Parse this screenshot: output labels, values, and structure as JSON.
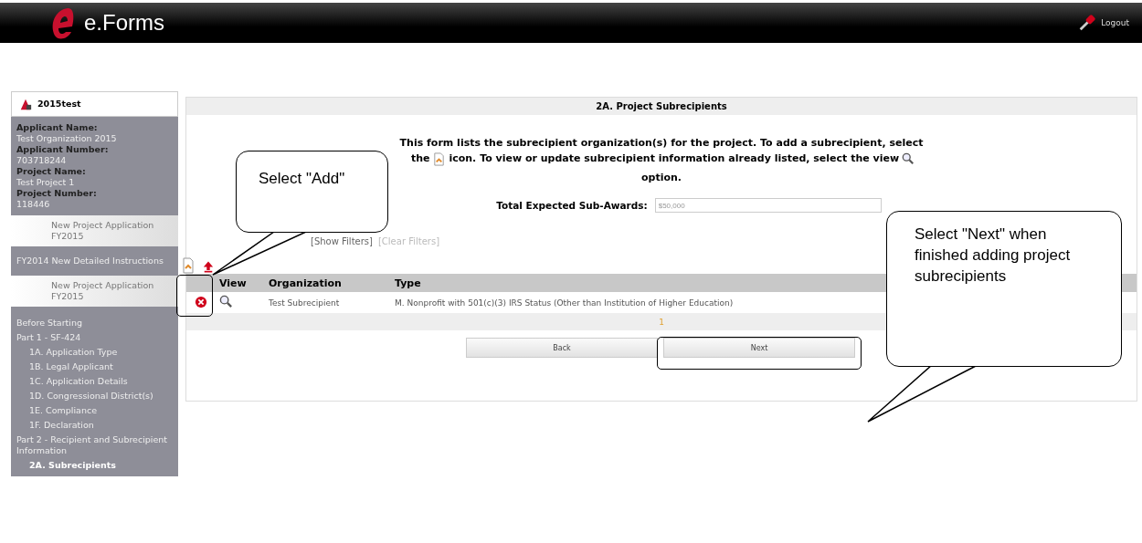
{
  "header": {
    "app_name": "e.Forms",
    "logout": "Logout"
  },
  "sidebar": {
    "title": "2015test",
    "info": [
      {
        "label": "Applicant Name:",
        "value": "Test Organization 2015"
      },
      {
        "label": "Applicant Number:",
        "value": "703718244"
      },
      {
        "label": "Project Name:",
        "value": "Test Project 1"
      },
      {
        "label": "Project Number:",
        "value": "118446"
      }
    ],
    "links": [
      {
        "text": "New Project Application FY2015",
        "kind": "tab"
      },
      {
        "text": "FY2014 New Detailed Instructions",
        "kind": "link"
      },
      {
        "text": "New Project Application FY2015",
        "kind": "tab"
      }
    ],
    "nav": [
      {
        "text": "Before Starting",
        "selected": false
      },
      {
        "text": "Part 1 - SF-424",
        "selected": false,
        "children": [
          {
            "text": "1A. Application Type",
            "selected": false
          },
          {
            "text": "1B. Legal Applicant",
            "selected": false
          },
          {
            "text": "1C. Application Details",
            "selected": false
          },
          {
            "text": "1D. Congressional District(s)",
            "selected": false
          },
          {
            "text": "1E. Compliance",
            "selected": false
          },
          {
            "text": "1F. Declaration",
            "selected": false
          }
        ]
      },
      {
        "text": "Part 2 - Recipient and Subrecipient Information",
        "selected": false,
        "children": [
          {
            "text": "2A. Subrecipients",
            "selected": true
          }
        ]
      }
    ]
  },
  "form": {
    "title": "2A. Project Subrecipients",
    "instructions": [
      "This form lists the subrecipient organization(s) for the project. To add a subrecipient, select",
      "the",
      "icon. To view or update subrecipient information already listed, select the view",
      "option."
    ],
    "field": {
      "label": "Total Expected Sub-Awards:",
      "value": "$50,000"
    },
    "filters": [
      "[Show Filters]",
      "[Clear Filters]"
    ],
    "table": {
      "columns": [
        "View",
        "Organization",
        "Type"
      ],
      "rows": [
        {
          "organization": "Test Subrecipient",
          "type": "M. Nonprofit with 501(c)(3) IRS Status (Other than Institution of Higher Education)"
        }
      ]
    },
    "pager": "1",
    "buttons": [
      "Back",
      "Next"
    ]
  },
  "callouts": [
    "Select \"Add\"",
    "Select \"Next\" when finished adding project subrecipients"
  ]
}
